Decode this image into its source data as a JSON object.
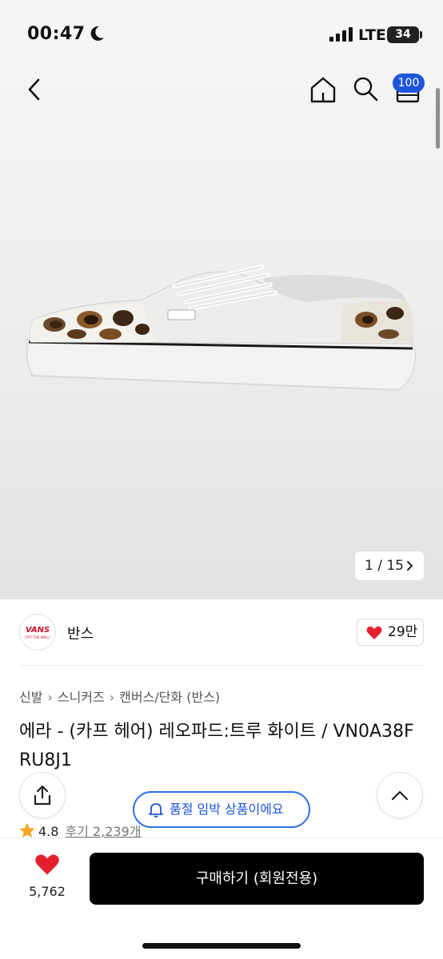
{
  "status_bar": {
    "time": "00:47",
    "network": "LTE",
    "battery": "34"
  },
  "nav": {
    "cart_badge": "100"
  },
  "gallery": {
    "current": "1",
    "total": "15",
    "counter": "1 / 15"
  },
  "brand": {
    "logo_text": "VANS",
    "logo_subtext": "\"OFF THE WALL\"",
    "name": "반스",
    "likes": "29만"
  },
  "breadcrumb": [
    "신발",
    "스니커즈",
    "캔버스/단화 (반스)"
  ],
  "product": {
    "title": "에라 - (카프 헤어) 레오파드:트루 화이트 / VN0A38FRU8J1"
  },
  "toast": {
    "message": "품절 임박 상품이에요"
  },
  "rating": {
    "score": "4.8",
    "reviews": "후기 2,239개"
  },
  "bottom_bar": {
    "wish_count": "5,762",
    "buy_label": "구매하기 (회원전용)"
  },
  "colors": {
    "accent_blue": "#1e56d9",
    "heart_red": "#e5202e",
    "star_yellow": "#f5a623",
    "buy_button": "#000000"
  }
}
